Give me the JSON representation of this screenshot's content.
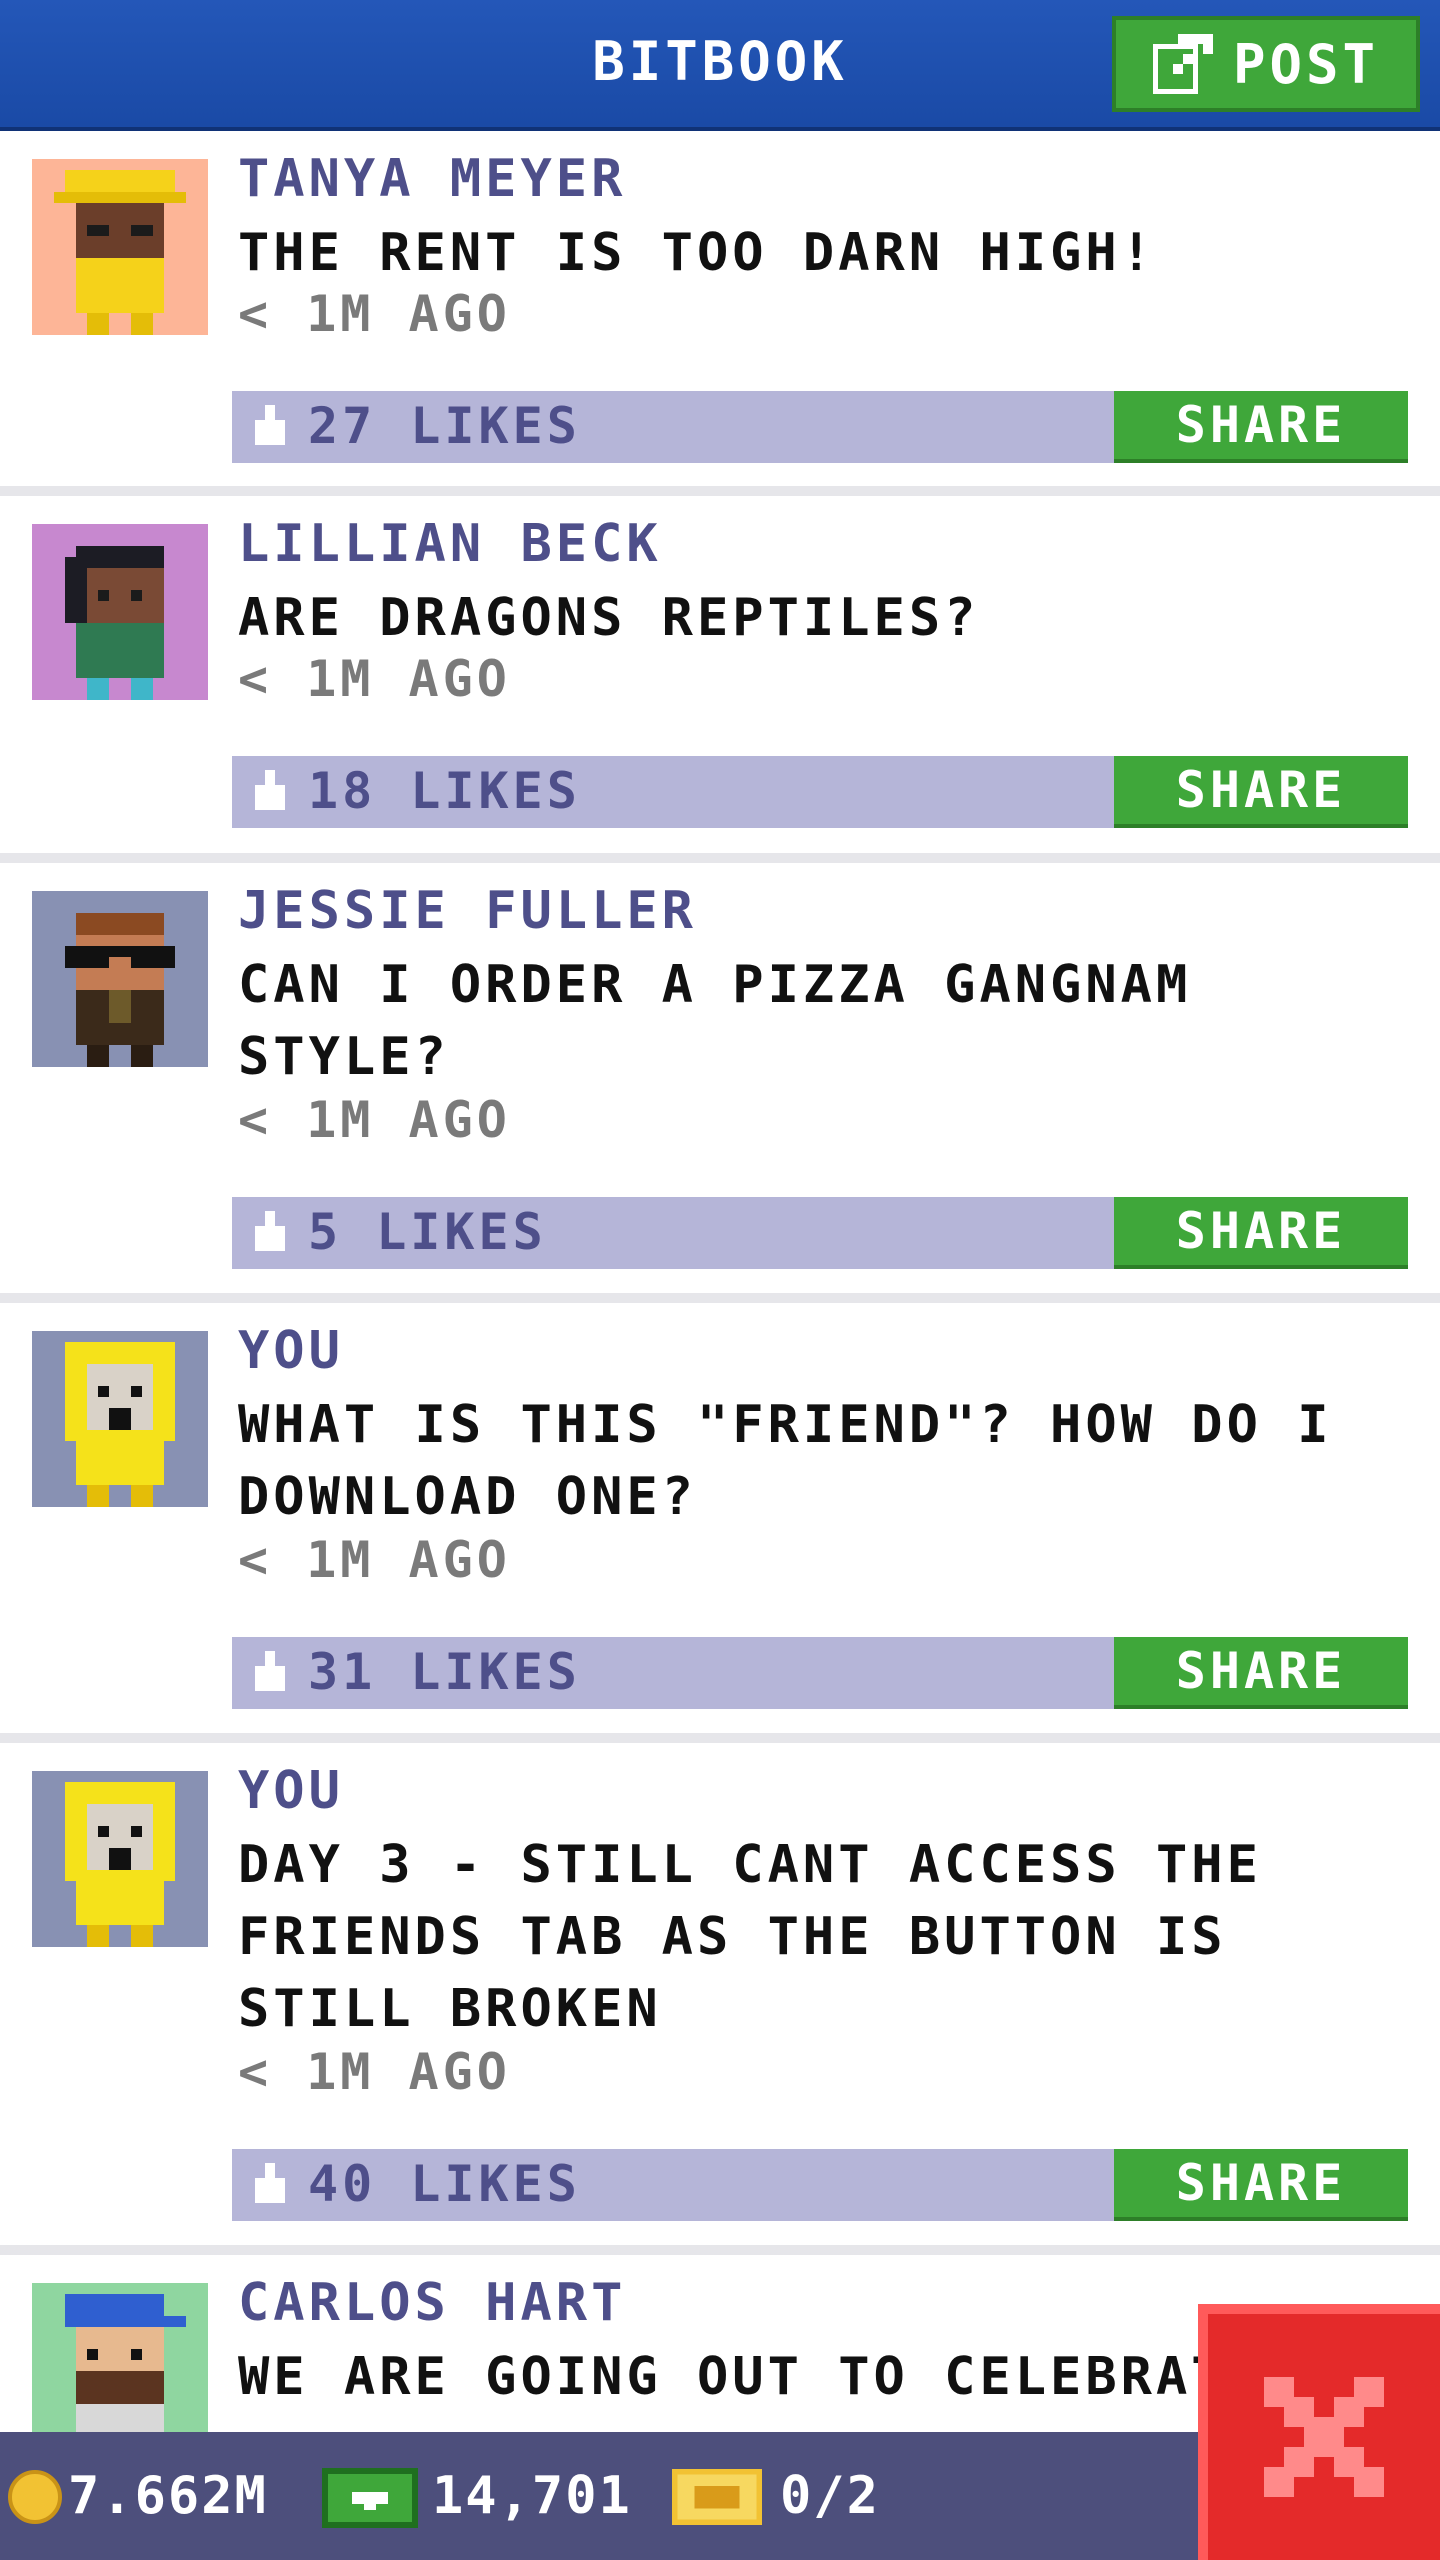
{
  "header": {
    "title": "BITBOOK",
    "post_label": "POST"
  },
  "posts": [
    {
      "author": "TANYA MEYER",
      "message": "THE RENT IS TOO DARN HIGH!",
      "time": "< 1M AGO",
      "likes": "27 LIKES",
      "share": "SHARE"
    },
    {
      "author": "LILLIAN BECK",
      "message": "ARE DRAGONS REPTILES?",
      "time": "< 1M AGO",
      "likes": "18 LIKES",
      "share": "SHARE"
    },
    {
      "author": "JESSIE FULLER",
      "message": "CAN I ORDER A PIZZA GANGNAM STYLE?",
      "time": "< 1M AGO",
      "likes": "5 LIKES",
      "share": "SHARE"
    },
    {
      "author": "YOU",
      "message": "WHAT IS THIS \"FRIEND\"? HOW DO I DOWNLOAD ONE?",
      "time": "< 1M AGO",
      "likes": "31 LIKES",
      "share": "SHARE"
    },
    {
      "author": "YOU",
      "message": "DAY 3 - STILL CANT ACCESS THE FRIENDS TAB AS THE BUTTON IS STILL BROKEN",
      "time": "< 1M AGO",
      "likes": "40 LIKES",
      "share": "SHARE"
    },
    {
      "author": "CARLOS HART",
      "message": "WE ARE GOING OUT TO CELEBRAT"
    }
  ],
  "status": {
    "coins": "7.662M",
    "bux": "14,701",
    "tickets": "0/2"
  },
  "icons": {
    "post": "compose-icon",
    "like": "thumbs-up-icon",
    "coin": "coin-icon",
    "bux": "bux-icon",
    "ticket": "ticket-icon",
    "close": "close-icon"
  },
  "colors": {
    "header": "#1a4aa6",
    "button_green": "#3fa73a",
    "likes_bar": "#b5b5d8",
    "author": "#4e4f8a",
    "close_red": "#e42a2a",
    "status_bar": "#4d4f7c"
  }
}
